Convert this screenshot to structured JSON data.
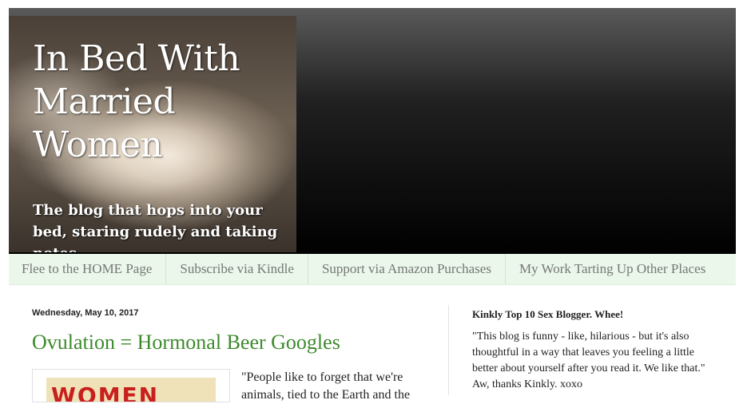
{
  "header": {
    "title": "In Bed With Married Women",
    "description": "The blog that hops into your bed, staring rudely and taking notes."
  },
  "nav": {
    "items": [
      {
        "label": "Flee to the HOME Page"
      },
      {
        "label": "Subscribe via Kindle"
      },
      {
        "label": "Support via Amazon Purchases"
      },
      {
        "label": "My Work Tarting Up Other Places"
      }
    ]
  },
  "post": {
    "date": "Wednesday, May 10, 2017",
    "title": "Ovulation = Hormonal Beer Googles",
    "image_text": "WOMEN",
    "body": "\"People like to forget that we're animals, tied to the Earth and the"
  },
  "sidebar": {
    "widget_title": "Kinkly Top 10 Sex Blogger. Whee!",
    "widget_text": "\"This blog is funny - like, hilarious - but it's also thoughtful in a way that leaves you feeling a little better about yourself after you read it. We like that.\" Aw, thanks Kinkly. xoxo"
  },
  "colors": {
    "nav_background": "#eaf7ea",
    "post_title": "#3c8a2c",
    "header_background": "#000000"
  }
}
